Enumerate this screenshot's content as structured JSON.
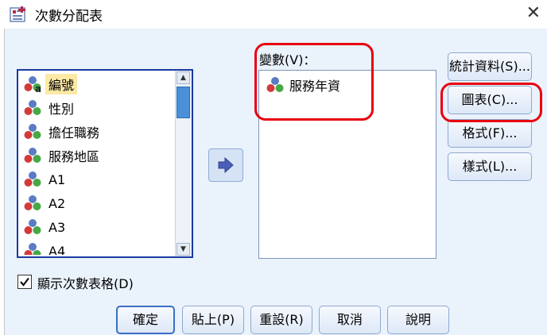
{
  "window": {
    "title": "次數分配表"
  },
  "source_list": {
    "items": [
      {
        "label": "編號",
        "selected": true
      },
      {
        "label": "性別"
      },
      {
        "label": "擔任職務"
      },
      {
        "label": "服務地區"
      },
      {
        "label": "A1"
      },
      {
        "label": "A2"
      },
      {
        "label": "A3"
      },
      {
        "label": "A4"
      }
    ]
  },
  "variables": {
    "label": "變數(V)：",
    "items": [
      {
        "label": "服務年資"
      }
    ]
  },
  "side_buttons": {
    "statistics": "統計資料(S)...",
    "charts": "圖表(C)...",
    "format": "格式(F)...",
    "style": "樣式(L)..."
  },
  "options": {
    "display_frequency_tables": {
      "label": "顯示次數表格(D)",
      "checked": true
    }
  },
  "footer": {
    "ok": "確定",
    "paste": "貼上(P)",
    "reset": "重設(R)",
    "cancel": "取消",
    "help": "說明"
  },
  "colors": {
    "annotation": "#e8000f",
    "selection": "#fbe9a5",
    "list_border": "#1a3aa0"
  },
  "icons": {
    "variable": "nominal-variable-icon",
    "move": "right-arrow-icon"
  }
}
